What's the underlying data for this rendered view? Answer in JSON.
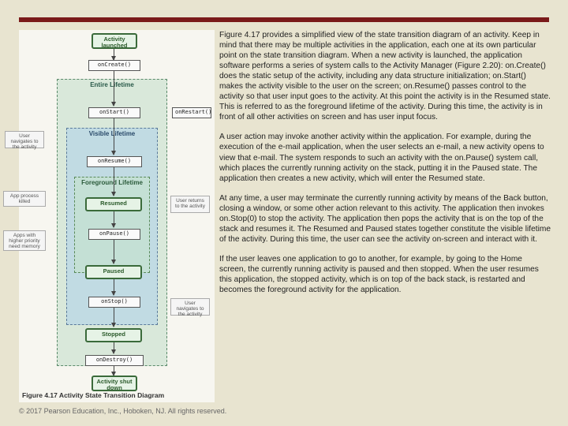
{
  "paragraphs": {
    "p1": "Figure 4.17 provides a simplified view of the state transition diagram of an activity. Keep in mind that there may be multiple activities in the application, each one at its own particular point on the state transition diagram. When a new activity is launched, the application software performs a series of system calls to the Activity Manager (Figure 2.20): on.Create()  does the static setup of the activity, including any data structure initialization; on.Start()  makes the activity visible to the user on the screen; on.Resume()  passes control to the activity so that user input goes to the activity. At this point the activity is in the Resumed state. This is referred to as the foreground lifetime  of the activity. During this time, the activity is in front of all other activities on screen and has user input focus.",
    "p2": "A user action may invoke another activity within the application. For example, during the execution of the e-mail application, when the user selects an e-mail, a new activity opens to view that e-mail. The system responds to such an activity with the on.Pause()  system call, which places the currently running activity on the stack, putting it in the Paused state. The application then creates a new activity, which will enter the Resumed state.",
    "p3": "At any time, a user may terminate the currently running activity by means of the Back button, closing a window, or some other action relevant to this activity. The application then invokes on.Stop(0)  to stop the activity. The application then pops the activity that is on the top of the stack and resumes it. The Resumed and Paused states together constitute the visible lifetime  of the activity. During this time, the user can see the activity on-screen and interact with it.",
    "p4": "If the user leaves one application to go to another, for example, by going to the Home screen, the currently running activity is paused and then stopped. When the user resumes this application, the stopped activity, which is on top of the back stack, is restarted and becomes the foreground activity for the application."
  },
  "footer": "© 2017 Pearson Education, Inc., Hoboken, NJ. All rights reserved.",
  "diagram": {
    "caption": "Figure 4.17   Activity State Transition Diagram",
    "launched": "Activity launched",
    "onCreate": "onCreate()",
    "onStart": "onStart()",
    "onResume": "onResume()",
    "resumed": "Resumed",
    "onPause": "onPause()",
    "paused": "Paused",
    "onStop": "onStop()",
    "stopped": "Stopped",
    "onDestroy": "onDestroy()",
    "shutdown": "Activity shut down",
    "onRestart": "onRestart()",
    "entire": "Entire Lifetime",
    "visible": "Visible Lifetime",
    "foreground": "Foreground Lifetime",
    "appKilled": "App process killed",
    "noteNav": "User navigates to the activity",
    "noteHigher": "Apps with higher priority need memory",
    "noteReturns": "User returns to the activity",
    "noteNoLonger": "User navigates to the activity"
  }
}
